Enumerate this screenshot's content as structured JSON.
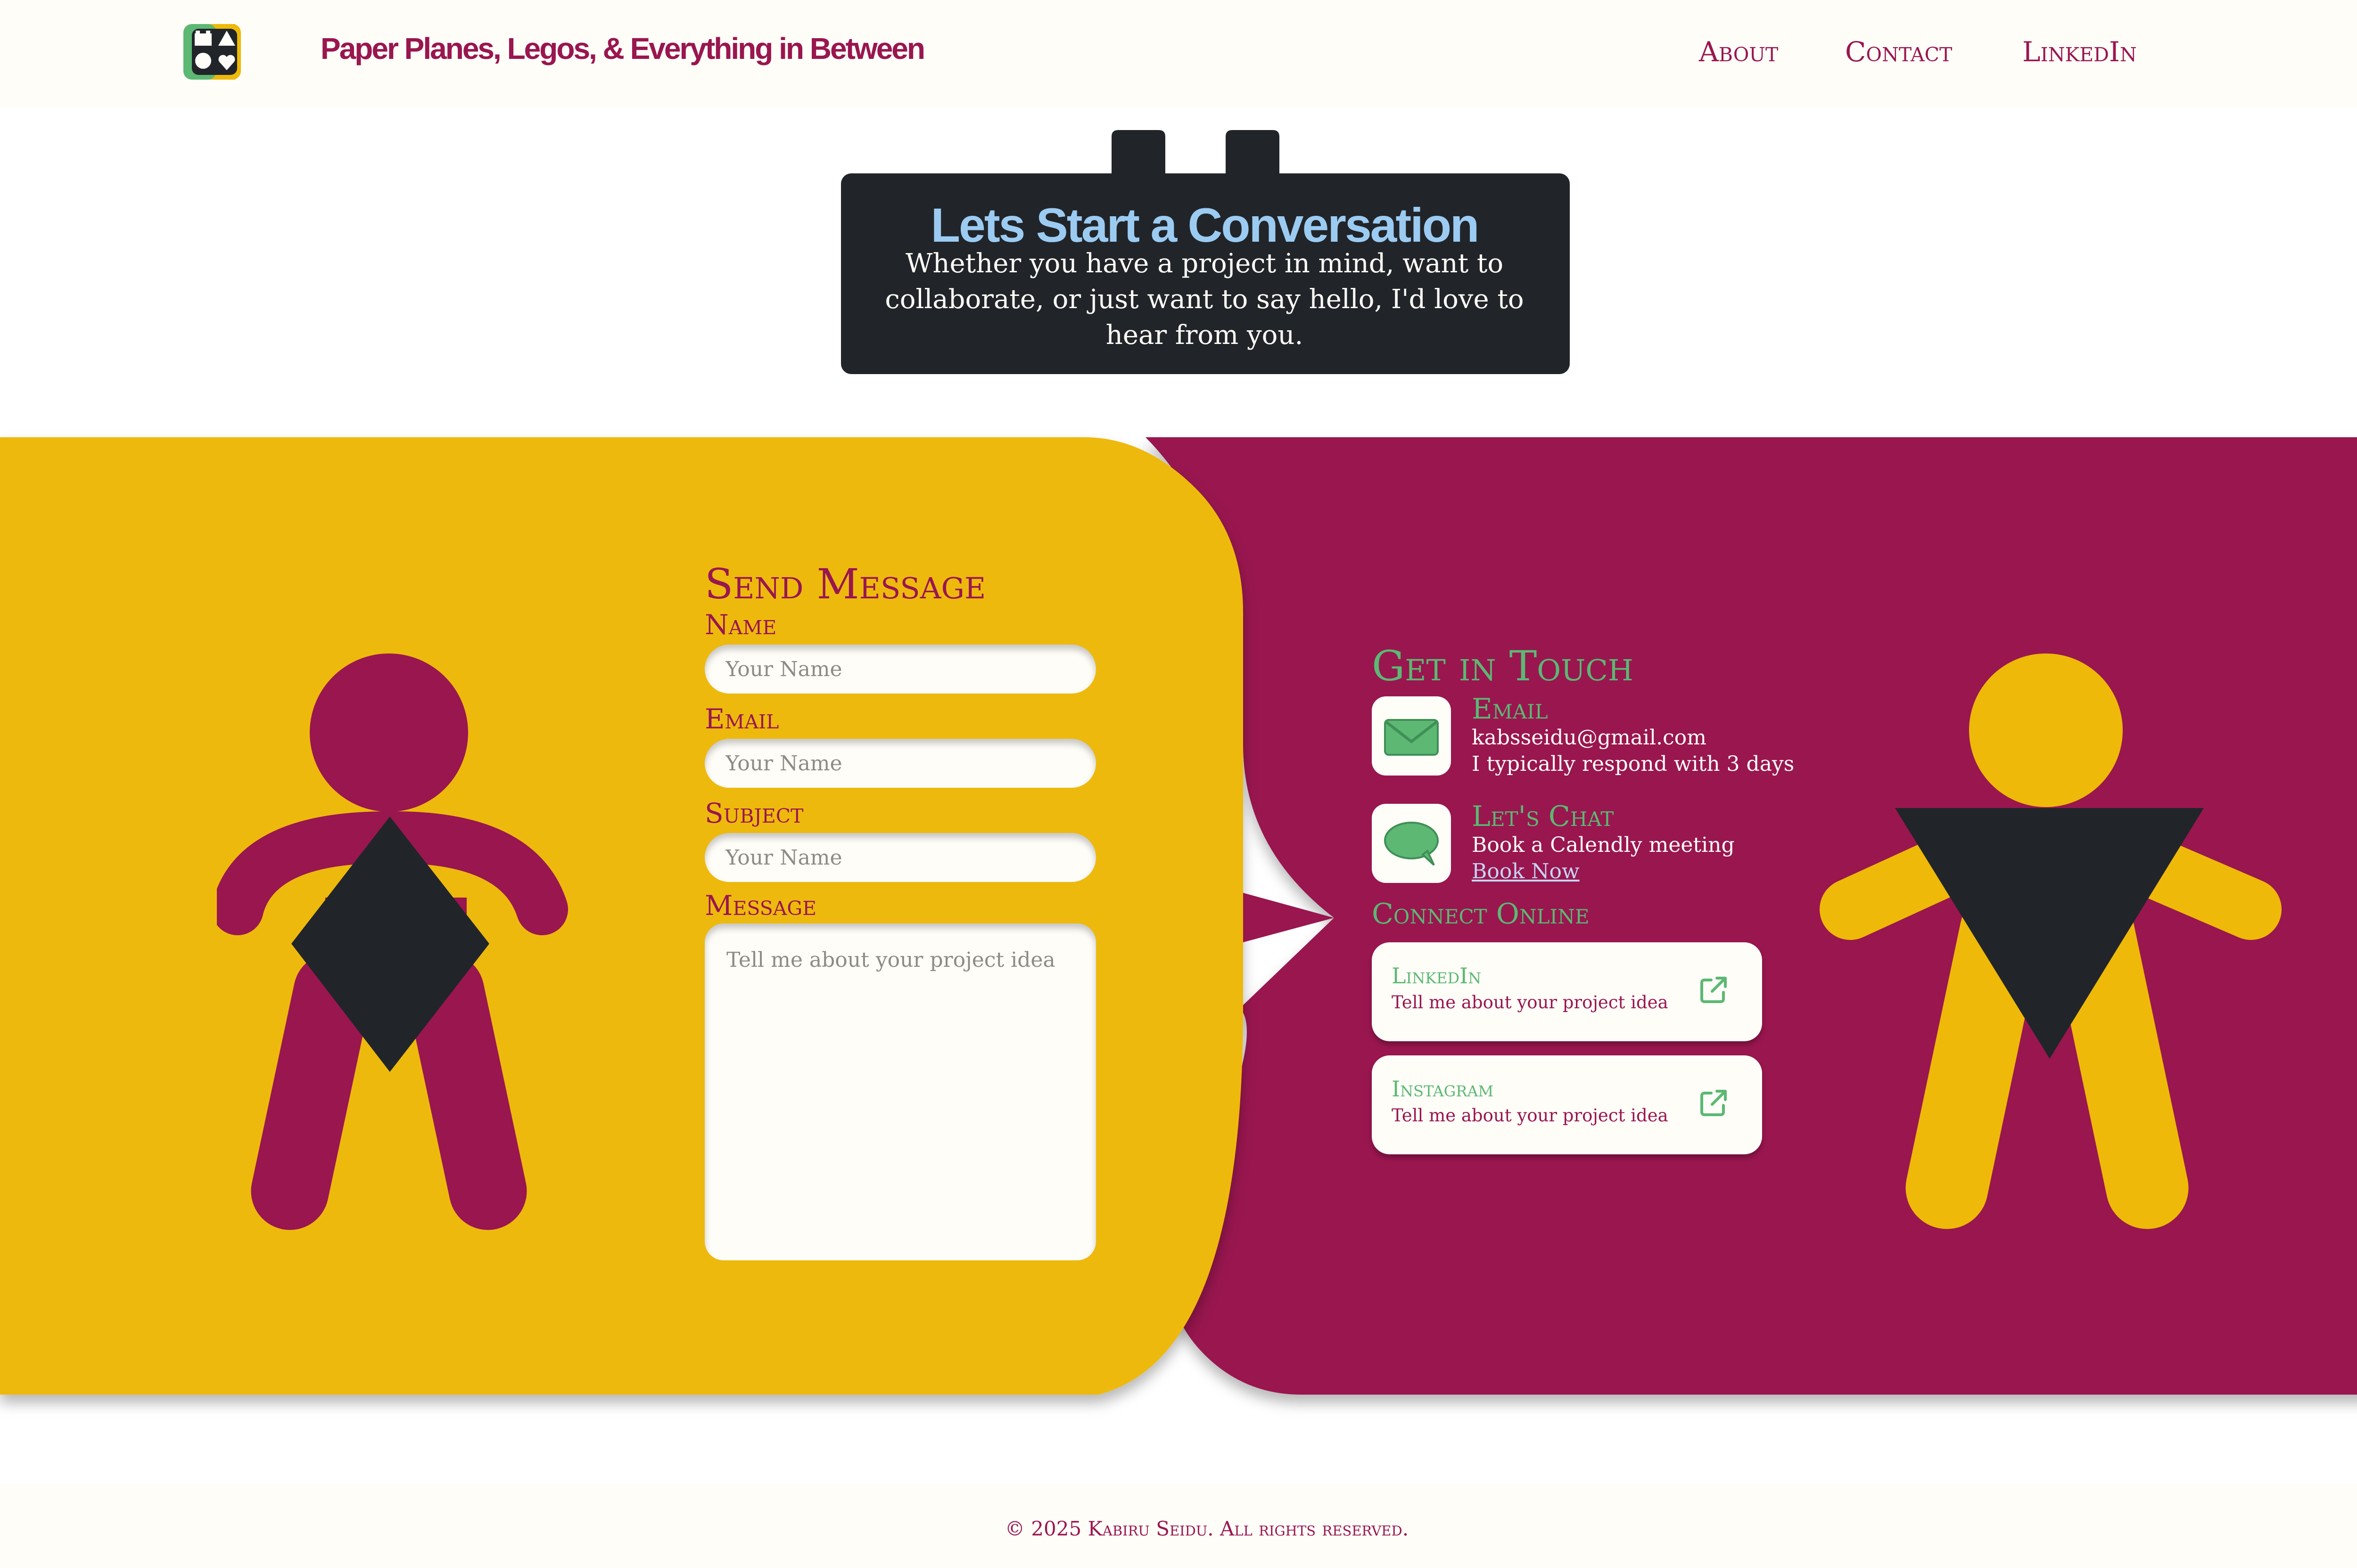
{
  "header": {
    "brand": "Paper Planes, Legos, & Everything in Between",
    "nav": [
      "About",
      "Contact",
      "LinkedIn"
    ]
  },
  "hero": {
    "title": "Lets Start a Conversation",
    "subtitle_lines": [
      "Whether you have a project in mind, want to",
      "collaborate, or just want to say hello, I'd love to",
      "hear from you."
    ]
  },
  "form": {
    "title": "Send Message",
    "name_label": "Name",
    "name_placeholder": "Your Name",
    "email_label": "Email",
    "email_placeholder": "Your Name",
    "subject_label": "Subject",
    "subject_placeholder": "Your Name",
    "message_label": "Message",
    "message_placeholder": "Tell me about your project idea"
  },
  "contact": {
    "title": "Get in Touch",
    "email": {
      "title": "Email",
      "address": "kabsseidu@gmail.com",
      "note": "I typically respond with 3 days",
      "icon": "envelope-icon"
    },
    "chat": {
      "title": "Let's Chat",
      "note": "Book a Calendly meeting",
      "link": "Book Now",
      "icon": "speech-bubble-icon"
    },
    "connect_title": "Connect Online",
    "socials": [
      {
        "title": "LinkedIn",
        "subtitle": "Tell me about your project idea",
        "icon": "external-link-icon"
      },
      {
        "title": "Instagram",
        "subtitle": "Tell me about your project idea",
        "icon": "external-link-icon"
      }
    ]
  },
  "footer": {
    "copyright": "© 2025 Kabiru Seidu. All rights reserved."
  },
  "colors": {
    "magenta": "#99164f",
    "yellow": "#eeb908",
    "dark": "#212529",
    "green": "#5cb873",
    "light_blue": "#9ccbf2",
    "cream": "#fefdf8"
  }
}
